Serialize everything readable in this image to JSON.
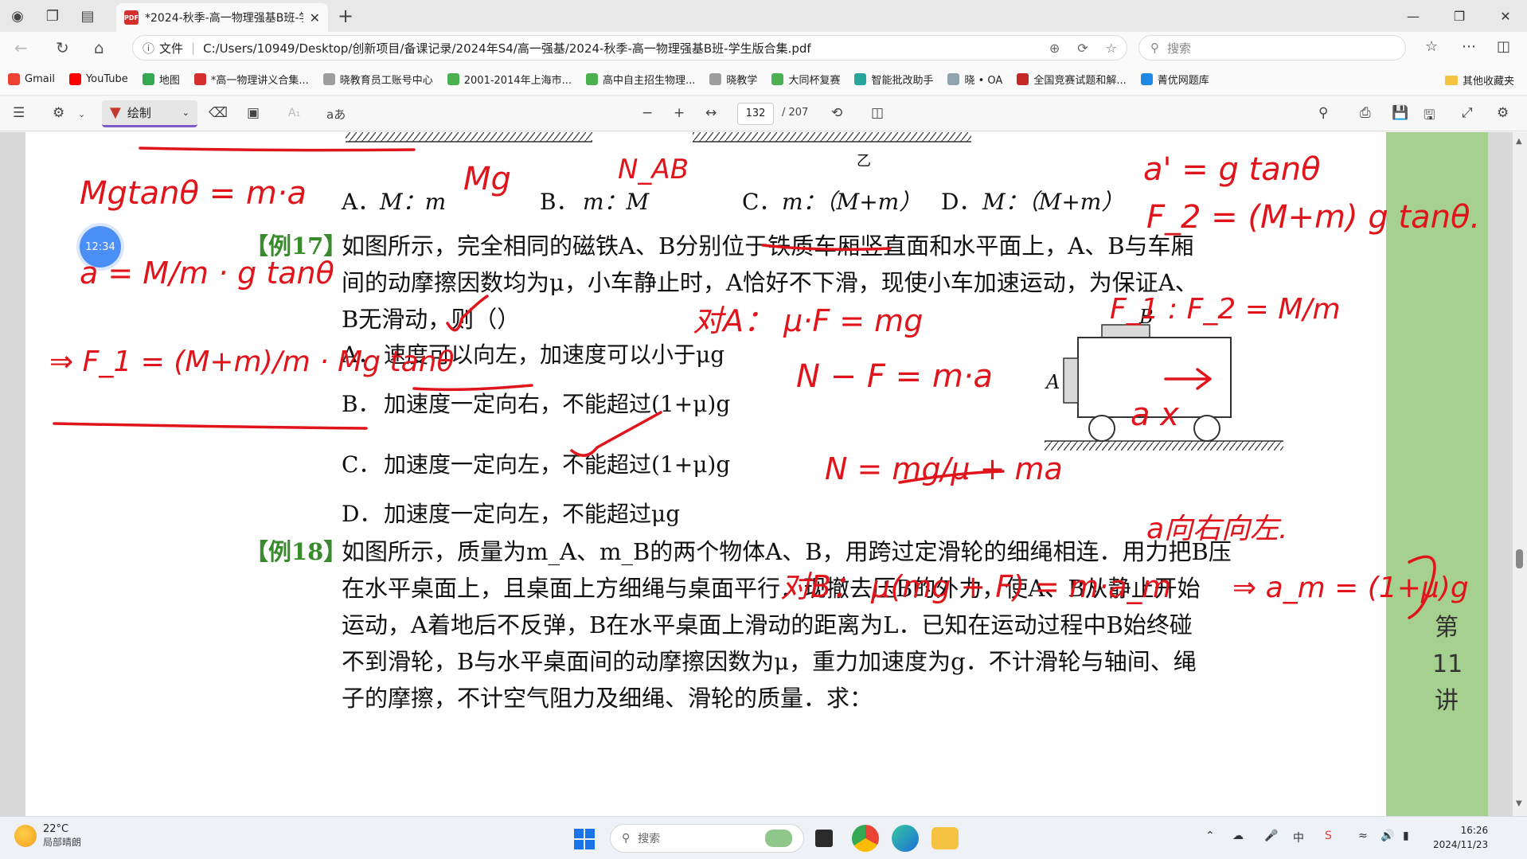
{
  "browser": {
    "tab_title": "*2024-秋季-高一物理强基B班-学...",
    "tab_close": "✕",
    "new_tab": "+",
    "address_info": "文件",
    "address": "C:/Users/10949/Desktop/创新项目/备课记录/2024年S4/高一强基/2024-秋季-高一物理强基B班-学生版合集.pdf",
    "search_placeholder": "搜索",
    "bookmarks": [
      {
        "label": "Gmail",
        "color": "#ea4335"
      },
      {
        "label": "YouTube",
        "color": "#ff0000"
      },
      {
        "label": "地图",
        "color": "#34a853"
      },
      {
        "label": "*高一物理讲义合集...",
        "color": "#d32f2f"
      },
      {
        "label": "晓教育员工账号中心",
        "color": "#9e9e9e"
      },
      {
        "label": "2001-2014年上海市...",
        "color": "#4caf50"
      },
      {
        "label": "高中自主招生物理...",
        "color": "#4caf50"
      },
      {
        "label": "晓教学",
        "color": "#9e9e9e"
      },
      {
        "label": "大同杯复赛",
        "color": "#4caf50"
      },
      {
        "label": "智能批改助手",
        "color": "#26a69a"
      },
      {
        "label": "晓 • OA",
        "color": "#90a4ae"
      },
      {
        "label": "全国竞赛试题和解...",
        "color": "#c62828"
      },
      {
        "label": "菁优网题库",
        "color": "#1e88e5"
      }
    ],
    "other_bookmarks": "其他收藏夹"
  },
  "pdf_toolbar": {
    "draw_label": "绘制",
    "text_size_icon": "aあ",
    "page_current": "132",
    "page_total": "/ 207",
    "zoom_out": "−",
    "zoom_in": "+"
  },
  "document": {
    "time_badge": "12:34",
    "top_options": {
      "a": "A．",
      "a_text": "M：m",
      "b": "B．",
      "b_text": "m：M",
      "c": "C．",
      "c_text": "m：（M+m）",
      "d": "D．",
      "d_text": "M：（M+m）"
    },
    "figure_yi": "乙",
    "ex17_label": "【例17】",
    "ex17_lines": [
      "如图所示，完全相同的磁铁A、B分别位于铁质车厢竖直面和水平面上，A、B与车厢",
      "间的动摩擦因数均为μ，小车静止时，A恰好不下滑，现使小车加速运动，为保证A、",
      "B无滑动，则（）"
    ],
    "ex17_options": [
      {
        "key": "A．",
        "text": "速度可以向左，加速度可以小于μg"
      },
      {
        "key": "B．",
        "text": "加速度一定向右，不能超过(1+μ)g"
      },
      {
        "key": "C．",
        "text": "加速度一定向左，不能超过(1+μ)g"
      },
      {
        "key": "D．",
        "text": "加速度一定向左，不能超过μg"
      }
    ],
    "figure_label_a": "A",
    "figure_label_b": "B",
    "ex18_label": "【例18】",
    "ex18_lines": [
      "如图所示，质量为m_A、m_B的两个物体A、B，用跨过定滑轮的细绳相连．用力把B压",
      "在水平桌面上，且桌面上方细绳与桌面平行．现撤去压B的外力，使A、B从静止开始",
      "运动，A着地后不反弹，B在水平桌面上滑动的距离为L．已知在运动过程中B始终碰",
      "不到滑轮，B与水平桌面间的动摩擦因数为μ，重力加速度为g．不计滑轮与轴间、绳",
      "子的摩擦，不计空气阻力及细绳、滑轮的质量．求："
    ],
    "side_lecture": [
      "第",
      "11",
      "讲"
    ]
  },
  "handwriting": {
    "color": "#e0141b",
    "notes": [
      "Mgtanθ = m·a",
      "a = M/m · g tanθ",
      "Mg",
      "N_AB",
      "a' = g tanθ",
      "F_2 = (M+m) g tanθ.",
      "⇒ F_1 = (M+m)/m · Mg tanθ",
      "对A：  μ·F = mg",
      "F_1 : F_2 = M/m",
      "N − F = m·a",
      "a x",
      "N = mg/μ + ma",
      "a向右向左.",
      "对B：  μ(mg + F) = m·a_m",
      "⇒ a_m = (1+μ)g"
    ]
  },
  "taskbar": {
    "temp": "22°C",
    "weather": "局部晴朗",
    "search_label": "搜索",
    "ime": "中",
    "time": "16:26",
    "date": "2024/11/23"
  }
}
